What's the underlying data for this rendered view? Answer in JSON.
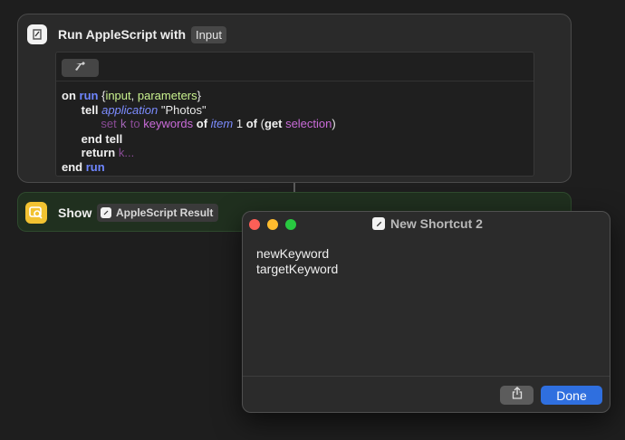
{
  "action": {
    "title": "Run AppleScript with",
    "input_token": "Input",
    "script": {
      "line1": {
        "on": "on",
        "run": "run",
        "open": " {",
        "input": "input",
        "comma": ", ",
        "parameters": "parameters",
        "close": "}"
      },
      "line2": {
        "tell": "tell",
        "application": "application",
        "app_name": " \"Photos\""
      },
      "line3": {
        "set": "set",
        "k": "k",
        "to": "to",
        "keywords": "keywords",
        "of": "of",
        "item": "item",
        "one": " 1 ",
        "of2": "of",
        "paren_open": " (",
        "get": "get",
        "selection": "selection",
        "paren_close": ")"
      },
      "line4": {
        "end": "end",
        "tell": "tell"
      },
      "line5": {
        "return": "return",
        "k": "k..."
      },
      "line6": {
        "end": "end",
        "run": "run"
      }
    }
  },
  "show_action": {
    "label": "Show",
    "result_token": "AppleScript Result"
  },
  "result_window": {
    "title": "New Shortcut 2",
    "output_lines": [
      "newKeyword",
      "targetKeyword"
    ],
    "done_label": "Done"
  },
  "colors": {
    "accent": "#2f6fdf",
    "show_icon": "#f2c231",
    "close_light": "#fe5f57",
    "minimize_light": "#febc2e",
    "zoom_light": "#28c840"
  },
  "icons": {
    "action_app": "shortcuts-script-icon",
    "compile": "hammer-icon",
    "show": "show-result-icon",
    "share": "share-icon"
  }
}
